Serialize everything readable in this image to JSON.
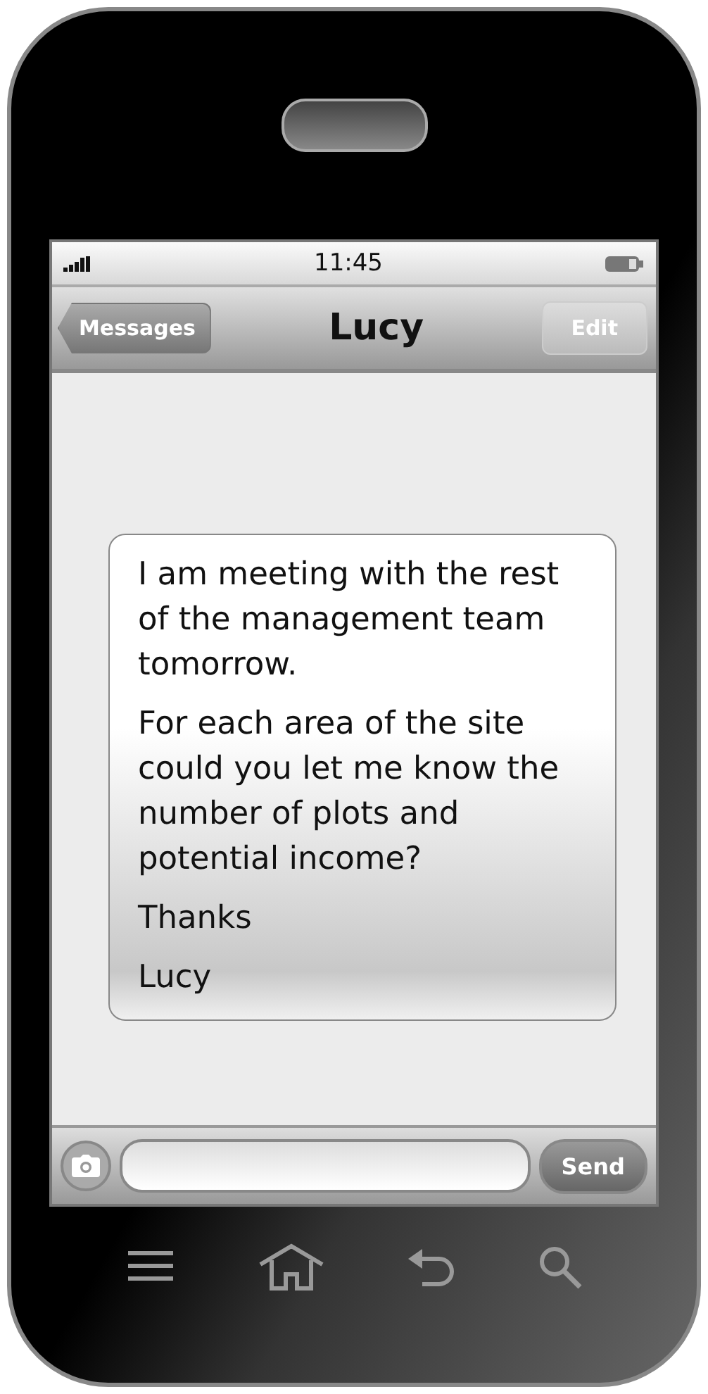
{
  "status_bar": {
    "time": "11:45"
  },
  "nav_bar": {
    "back": "Messages",
    "title": "Lucy",
    "action": "Edit"
  },
  "message": {
    "paragraphs": [
      "I am meeting with the rest of the management team tomorrow.",
      "For each area of the site could you let me know the number of plots and potential income?",
      "Thanks",
      "Lucy"
    ]
  },
  "composer": {
    "send": "Send"
  }
}
